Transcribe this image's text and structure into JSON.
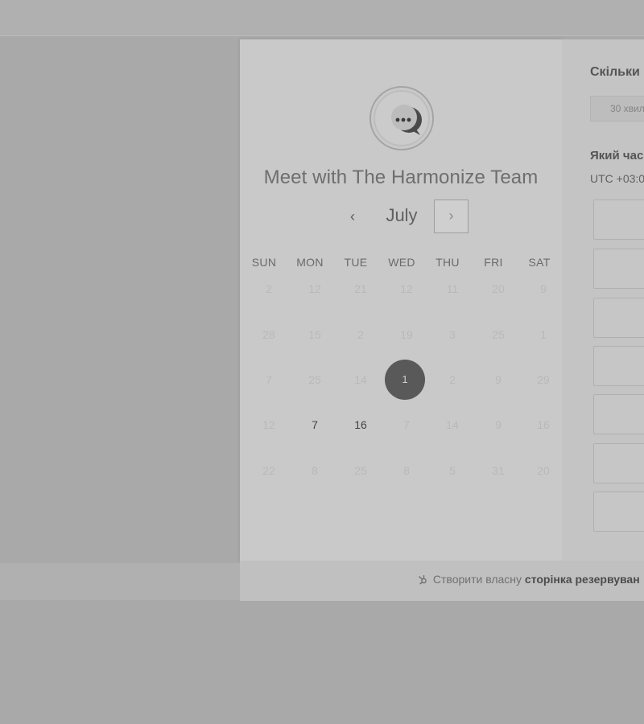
{
  "header": {
    "title": "Meet with The Harmonize Team"
  },
  "calendar": {
    "month": "July",
    "prev_icon": "‹",
    "next_icon": "›",
    "weekdays": [
      "SUN",
      "MON",
      "TUE",
      "WED",
      "THU",
      "FRI",
      "SAT"
    ],
    "rows": [
      [
        "2",
        "12",
        "21",
        "12",
        "11",
        "20",
        "9"
      ],
      [
        "28",
        "15",
        "2",
        "19",
        "3",
        "25",
        "1"
      ],
      [
        "7",
        "25",
        "14",
        "1",
        "2",
        "9",
        "29"
      ],
      [
        "12",
        "7",
        "16",
        "7",
        "14",
        "9",
        "16"
      ],
      [
        "22",
        "8",
        "25",
        "8",
        "5",
        "31",
        "20"
      ]
    ],
    "selected_day": "1"
  },
  "right_panel": {
    "duration_question": "Скільки",
    "duration_option": "30 хвил",
    "time_question": "Який час",
    "timezone": "UTC +03:0"
  },
  "footer": {
    "prefix": "Створити власну",
    "link": "сторінка резервуван"
  },
  "colors": {
    "card": "#c9c9c9",
    "selected": "#595959",
    "overlay": "#a9a9a9"
  },
  "icons": {
    "logo": "chat-bubble-icon",
    "footer": "hubspot-sprocket-icon"
  }
}
